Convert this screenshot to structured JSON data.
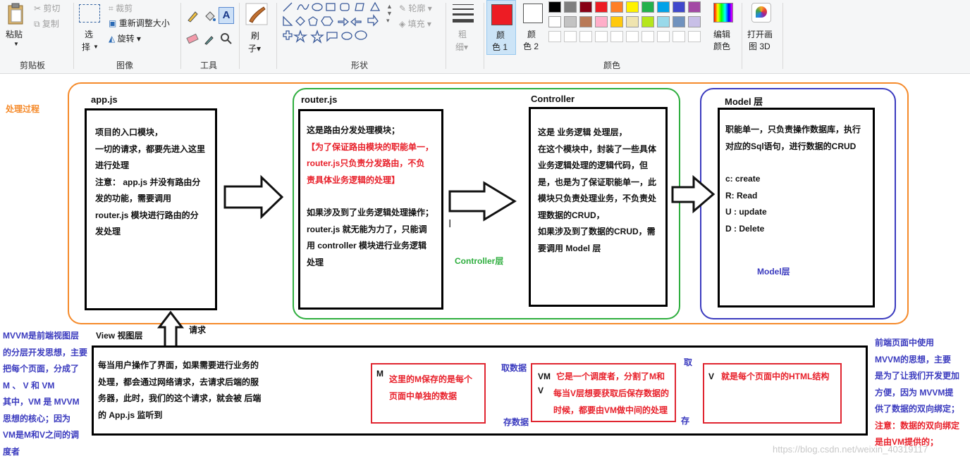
{
  "ribbon": {
    "clipboard": {
      "paste": "粘贴",
      "cut": "剪切",
      "copy": "复制",
      "group": "剪贴板"
    },
    "image": {
      "select": "选",
      "select2": "择",
      "crop": "裁剪",
      "resize": "重新调整大小",
      "rotate": "旋转",
      "group": "图像"
    },
    "tools": {
      "group": "工具"
    },
    "brush": {
      "label1": "刷",
      "label2": "子"
    },
    "shapes": {
      "outline": "轮廓",
      "fill": "填充",
      "group": "形状"
    },
    "size": {
      "label1": "粗",
      "label2": "细"
    },
    "color1": {
      "label1": "颜",
      "label2": "色 1",
      "value": "#ed1c24"
    },
    "color2": {
      "label1": "颜",
      "label2": "色 2",
      "value": "#ffffff"
    },
    "colors": {
      "group": "颜色",
      "row1": [
        "#000000",
        "#7f7f7f",
        "#880015",
        "#ed1c24",
        "#ff7f27",
        "#fff200",
        "#22b14c",
        "#00a2e8",
        "#3f48cc",
        "#a349a4"
      ],
      "row2": [
        "#ffffff",
        "#c3c3c3",
        "#b97a57",
        "#ffaec9",
        "#ffc90e",
        "#efe4b0",
        "#b5e61d",
        "#99d9ea",
        "#7092be",
        "#c8bfe7"
      ],
      "row3_count": 10
    },
    "edit_colors": {
      "label1": "编辑",
      "label2": "颜色"
    },
    "paint3d": {
      "label1": "打开画",
      "label2": "图 3D"
    }
  },
  "canvas": {
    "process_label": "处理过程",
    "appjs": {
      "title": "app.js",
      "lines": [
        "项目的入口模块，",
        "一切的请求，都要先进入这里",
        "进行处理",
        "注意： app.js 并没有路由分",
        "发的功能，需要调用",
        "router.js 模块进行路由的分",
        "发处理"
      ]
    },
    "router": {
      "title": "router.js",
      "line1": "这是路由分发处理模块；",
      "red_lines": [
        "【为了保证路由模块的职能单一，",
        "router.js只负责分发路由，不负",
        "责具体业务逻辑的处理】"
      ],
      "lines2": [
        "如果涉及到了业务逻辑处理操作；",
        "router.js 就无能为力了，只能调",
        "用 controller 模块进行业务逻辑",
        "处理"
      ]
    },
    "controller": {
      "title": "Controller",
      "layer_label": "Controller层",
      "lines": [
        "这是 业务逻辑 处理层，",
        "在这个模块中，封装了一些具体",
        "业务逻辑处理的逻辑代码，但",
        "是，也是为了保证职能单一，此",
        "模块只负责处理业务，不负责处",
        "理数据的CRUD，",
        "如果涉及到了数据的CRUD，需",
        "要调用 Model 层"
      ]
    },
    "model": {
      "title": "Model 层",
      "layer_label": "Model层",
      "lines1": [
        "职能单一，只负责操作数据库，执行",
        "对应的Sql语句，进行数据的CRUD"
      ],
      "crud": [
        "c:  create",
        "R: Read",
        "U : update",
        "D : Delete"
      ]
    },
    "view": {
      "title": "View 视图层",
      "request": "请求",
      "lines": [
        "每当用户操作了界面，如果需要进行业务的",
        "处理，都会通过网络请求，去请求后端的服",
        "务器，此时，我们的这个请求，就会被 后端",
        "的 App.js 监听到"
      ]
    },
    "mvvm_left": [
      "MVVM是前端视图层",
      "的分层开发思想，主要",
      "把每个页面，分成了",
      "M 、 V 和 VM",
      "其中，VM 是 MVVM",
      "思想的核心；因为",
      "VM是M和V之间的调",
      "度者"
    ],
    "mvvm_right": {
      "lines": [
        "前端页面中使用",
        "MVVM的思想，主要",
        "是为了让我们开发更加",
        "方便，因为 MVVM提",
        "供了数据的双向绑定；"
      ],
      "red_lines": [
        "注意：数据的双向绑定",
        "是由VM提供的；"
      ]
    },
    "m_box": {
      "label": "M",
      "lines": [
        "这里的M保存的是每个",
        "页面中单独的数据"
      ]
    },
    "vm_box": {
      "label1": "VM",
      "label2": "V",
      "lines": [
        "它是一个调度者，分割了M和",
        "每当V层想要获取后保存数据的",
        "时候，都要由VM做中间的处理"
      ]
    },
    "v_box": {
      "label": "V",
      "text": "就是每个页面中的HTML结构"
    },
    "arrows": {
      "fetch_data": "取数据",
      "save_data": "存数据",
      "fetch": "取",
      "save": "存"
    },
    "watermark": "https://blog.csdn.net/weixin_40319117"
  }
}
